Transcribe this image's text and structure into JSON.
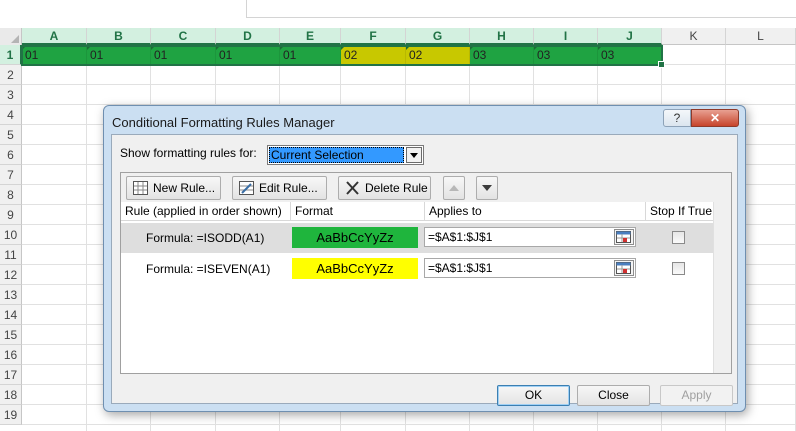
{
  "spreadsheet": {
    "columns": [
      "A",
      "B",
      "C",
      "D",
      "E",
      "F",
      "G",
      "H",
      "I",
      "J",
      "K",
      "L"
    ],
    "rows": [
      "1",
      "2",
      "3",
      "4",
      "5",
      "6",
      "7",
      "8",
      "9",
      "10",
      "11",
      "12",
      "13",
      "14",
      "15",
      "16",
      "17",
      "18",
      "19"
    ],
    "row1_cells": [
      "01",
      "01",
      "01",
      "01",
      "01",
      "02",
      "02",
      "03",
      "03",
      "03"
    ],
    "colors": {
      "odd_fill": "#1fa342",
      "even_fill": "#c8c800",
      "selection": "#217346"
    }
  },
  "dialog": {
    "title": "Conditional Formatting Rules Manager",
    "help_glyph": "?",
    "close_glyph": "✕",
    "show_label": "Show formatting rules for:",
    "show_value": "Current Selection",
    "toolbar": {
      "new_rule": "New Rule...",
      "edit_rule": "Edit Rule...",
      "delete_rule": "Delete Rule"
    },
    "headers": {
      "rule": "Rule (applied in order shown)",
      "format": "Format",
      "applies": "Applies to",
      "stop": "Stop If True"
    },
    "rules": [
      {
        "name": "Formula: =ISODD(A1)",
        "format_preview": "AaBbCcYyZz",
        "applies_to": "=$A$1:$J$1",
        "color": "#1fb53d"
      },
      {
        "name": "Formula: =ISEVEN(A1)",
        "format_preview": "AaBbCcYyZz",
        "applies_to": "=$A$1:$J$1",
        "color": "#ffff00"
      }
    ],
    "buttons": {
      "ok": "OK",
      "close": "Close",
      "apply": "Apply"
    }
  }
}
